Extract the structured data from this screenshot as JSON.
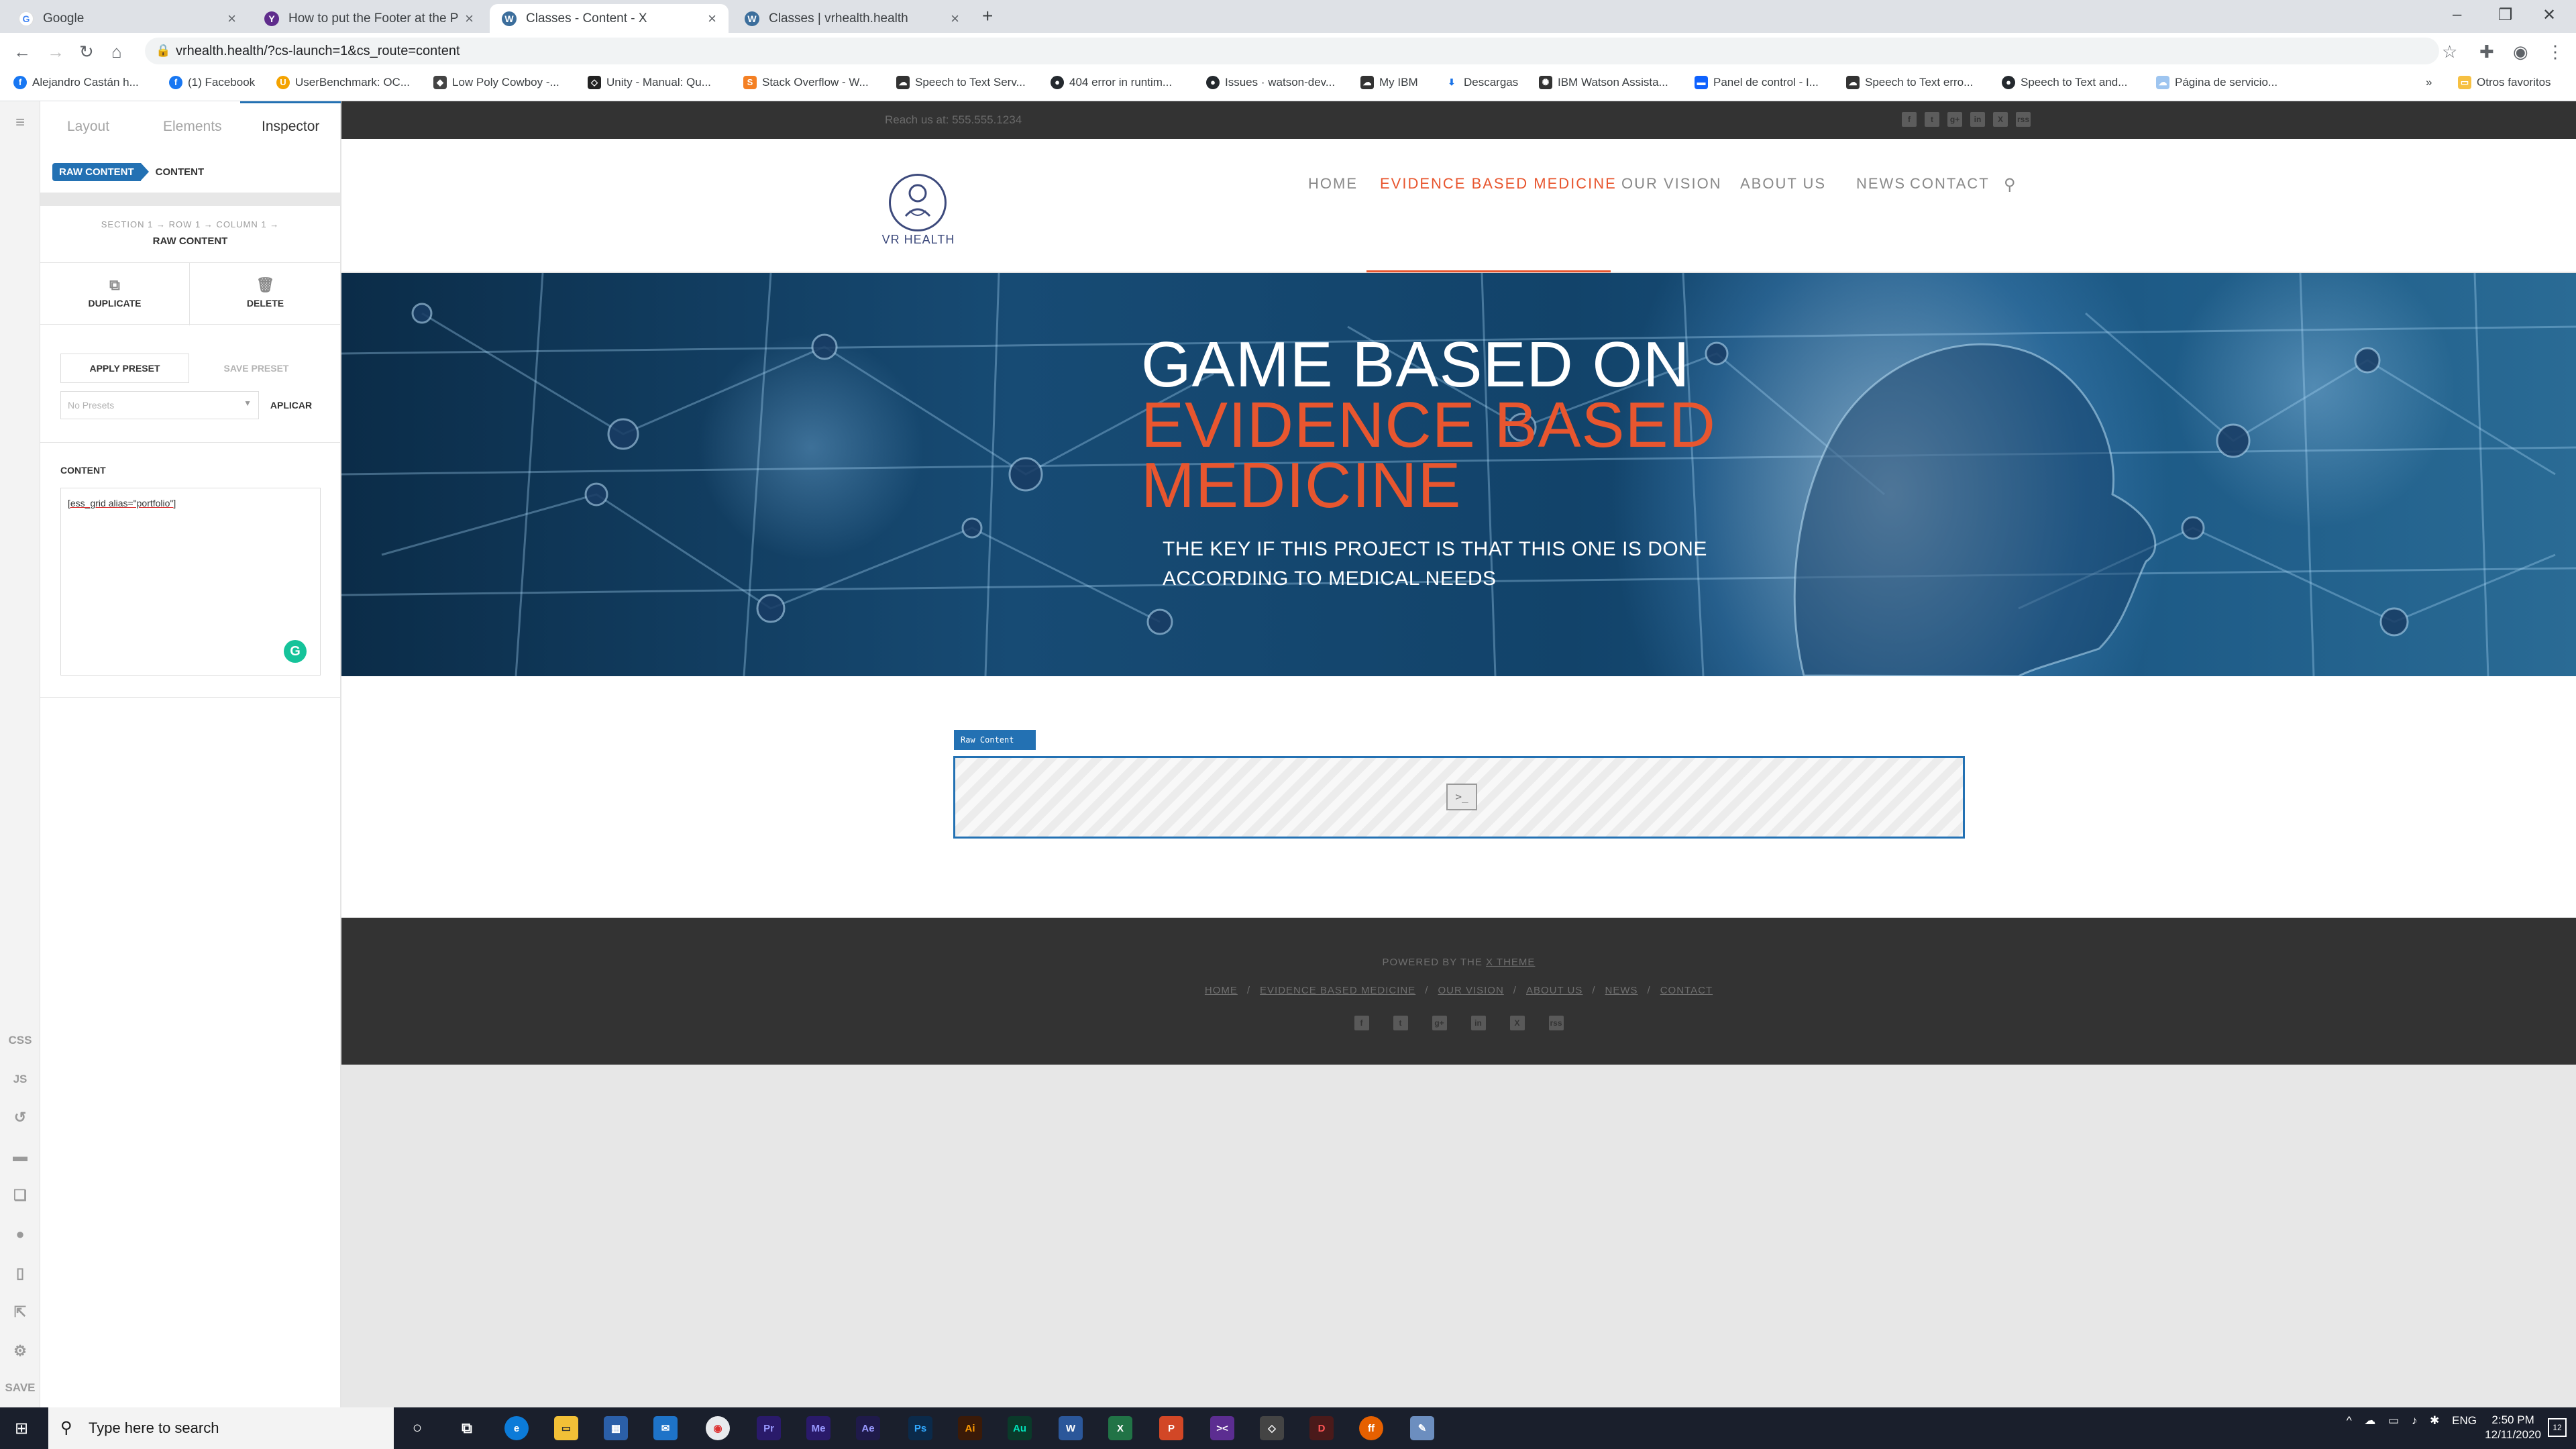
{
  "browser": {
    "tabs": [
      {
        "title": "Google",
        "active": false
      },
      {
        "title": "How to put the Footer at the Pag",
        "active": false
      },
      {
        "title": "Classes - Content - X",
        "active": true
      },
      {
        "title": "Classes | vrhealth.health",
        "active": false
      }
    ],
    "new_tab": "+",
    "url": "vrhealth.health/?cs-launch=1&cs_route=content",
    "bookmarks": [
      "Alejandro Castán h...",
      "(1) Facebook",
      "UserBenchmark: OC...",
      "Low Poly Cowboy -...",
      "Unity - Manual: Qu...",
      "Stack Overflow - W...",
      "Speech to Text Serv...",
      "404 error in runtim...",
      "Issues · watson-dev...",
      "My IBM",
      "Descargas",
      "IBM Watson Assista...",
      "Panel de control - I...",
      "Speech to Text erro...",
      "Speech to Text and...",
      "Página de servicio..."
    ],
    "bookmarks_more": "»",
    "other_bookmarks": "Otros favoritos"
  },
  "rail": {
    "css": "CSS",
    "js": "JS",
    "save": "SAVE"
  },
  "inspector": {
    "tabs": [
      "Layout",
      "Elements",
      "Inspector"
    ],
    "breadcrumb": {
      "element": "RAW CONTENT",
      "sub": "CONTENT"
    },
    "path": "SECTION 1 → ROW 1 → COLUMN 1 →",
    "path_current": "RAW CONTENT",
    "duplicate": "DUPLICATE",
    "delete": "DELETE",
    "apply_preset": "APPLY PRESET",
    "save_preset": "SAVE PRESET",
    "preset_placeholder": "No Presets",
    "aplicar": "APLICAR",
    "content_label": "CONTENT",
    "content_value": "[ess_grid alias=\"portfolio\"]"
  },
  "site": {
    "reach": "Reach us at: 555.555.1234",
    "logo_text": "VR HEALTH",
    "nav": [
      "HOME",
      "EVIDENCE BASED MEDICINE",
      "OUR VISION",
      "ABOUT US",
      "NEWS",
      "CONTACT"
    ],
    "nav_active": "EVIDENCE BASED MEDICINE",
    "hero": {
      "line1": "GAME BASED ON",
      "line2": "EVIDENCE BASED",
      "line3": "MEDICINE",
      "subtitle": "THE KEY IF THIS PROJECT IS THAT THIS ONE IS DONE ACCORDING TO MEDICAL NEEDS"
    },
    "raw_content_tag": "Raw Content",
    "raw_content_icon": ">_",
    "footer": {
      "powered_prefix": "POWERED BY THE",
      "powered_link": "X THEME",
      "links": [
        "HOME",
        "EVIDENCE BASED MEDICINE",
        "OUR VISION",
        "ABOUT US",
        "NEWS",
        "CONTACT"
      ],
      "separator": "/"
    },
    "social": [
      "f",
      "t",
      "g+",
      "in",
      "X",
      "rss"
    ]
  },
  "taskbar": {
    "search_placeholder": "Type here to search",
    "language": "ENG",
    "time": "2:50 PM",
    "date": "12/11/2020",
    "notifications": "12"
  },
  "colors": {
    "accent": "#e8562f",
    "builder_blue": "#2371b3",
    "dark": "#333333",
    "logo": "#3d4a7c"
  }
}
